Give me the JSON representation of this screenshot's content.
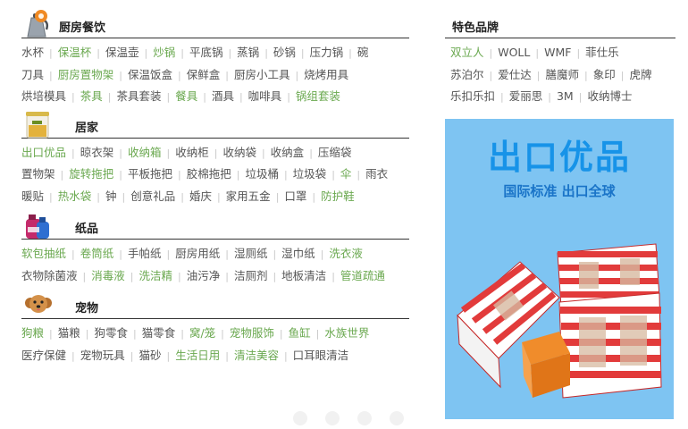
{
  "sections": [
    {
      "title": "厨房餐饮",
      "icon": "kettle-icon",
      "rows": [
        [
          {
            "t": "水杯",
            "hl": false
          },
          {
            "t": "保温杯",
            "hl": true
          },
          {
            "t": "保温壶",
            "hl": false
          },
          {
            "t": "炒锅",
            "hl": true
          },
          {
            "t": "平底锅",
            "hl": false
          },
          {
            "t": "蒸锅",
            "hl": false
          },
          {
            "t": "砂锅",
            "hl": false
          },
          {
            "t": "压力锅",
            "hl": false
          },
          {
            "t": "碗",
            "hl": false
          }
        ],
        [
          {
            "t": "刀具",
            "hl": false
          },
          {
            "t": "厨房置物架",
            "hl": true
          },
          {
            "t": "保温饭盒",
            "hl": false
          },
          {
            "t": "保鲜盒",
            "hl": false
          },
          {
            "t": "厨房小工具",
            "hl": false
          },
          {
            "t": "烧烤用具",
            "hl": false
          }
        ],
        [
          {
            "t": "烘培模具",
            "hl": false
          },
          {
            "t": "茶具",
            "hl": true
          },
          {
            "t": "茶具套装",
            "hl": false
          },
          {
            "t": "餐具",
            "hl": true
          },
          {
            "t": "酒具",
            "hl": false
          },
          {
            "t": "咖啡具",
            "hl": false
          },
          {
            "t": "锅组套装",
            "hl": true
          }
        ]
      ]
    },
    {
      "title": "居家",
      "icon": "storage-jar-icon",
      "rows": [
        [
          {
            "t": "出口优品",
            "hl": true
          },
          {
            "t": "晾衣架",
            "hl": false
          },
          {
            "t": "收纳箱",
            "hl": true
          },
          {
            "t": "收纳柜",
            "hl": false
          },
          {
            "t": "收纳袋",
            "hl": false
          },
          {
            "t": "收纳盒",
            "hl": false
          },
          {
            "t": "压缩袋",
            "hl": false
          }
        ],
        [
          {
            "t": "置物架",
            "hl": false
          },
          {
            "t": "旋转拖把",
            "hl": true
          },
          {
            "t": "平板拖把",
            "hl": false
          },
          {
            "t": "胶棉拖把",
            "hl": false
          },
          {
            "t": "垃圾桶",
            "hl": false
          },
          {
            "t": "垃圾袋",
            "hl": false
          },
          {
            "t": "伞",
            "hl": true
          },
          {
            "t": "雨衣",
            "hl": false
          }
        ],
        [
          {
            "t": "暖贴",
            "hl": false
          },
          {
            "t": "热水袋",
            "hl": true
          },
          {
            "t": "钟",
            "hl": false
          },
          {
            "t": "创意礼品",
            "hl": false
          },
          {
            "t": "婚庆",
            "hl": false
          },
          {
            "t": "家用五金",
            "hl": false
          },
          {
            "t": "口罩",
            "hl": false
          },
          {
            "t": "防护鞋",
            "hl": true
          }
        ]
      ]
    },
    {
      "title": "纸品",
      "icon": "detergent-bottle-icon",
      "rows": [
        [
          {
            "t": "软包抽纸",
            "hl": true
          },
          {
            "t": "卷筒纸",
            "hl": true
          },
          {
            "t": "手帕纸",
            "hl": false
          },
          {
            "t": "厨房用纸",
            "hl": false
          },
          {
            "t": "湿厕纸",
            "hl": false
          },
          {
            "t": "湿巾纸",
            "hl": false
          },
          {
            "t": "洗衣液",
            "hl": true
          }
        ],
        [
          {
            "t": "衣物除菌液",
            "hl": false
          },
          {
            "t": "消毒液",
            "hl": true
          },
          {
            "t": "洗洁精",
            "hl": true
          },
          {
            "t": "油污净",
            "hl": false
          },
          {
            "t": "洁厕剂",
            "hl": false
          },
          {
            "t": "地板清洁",
            "hl": false
          },
          {
            "t": "管道疏通",
            "hl": true
          }
        ]
      ]
    },
    {
      "title": "宠物",
      "icon": "dog-icon",
      "rows": [
        [
          {
            "t": "狗粮",
            "hl": true
          },
          {
            "t": "猫粮",
            "hl": false
          },
          {
            "t": "狗零食",
            "hl": false
          },
          {
            "t": "猫零食",
            "hl": false
          },
          {
            "t": "窝/笼",
            "hl": true
          },
          {
            "t": "宠物服饰",
            "hl": true
          },
          {
            "t": "鱼缸",
            "hl": true
          },
          {
            "t": "水族世界",
            "hl": true
          }
        ],
        [
          {
            "t": "医疗保健",
            "hl": false
          },
          {
            "t": "宠物玩具",
            "hl": false
          },
          {
            "t": "猫砂",
            "hl": false
          },
          {
            "t": "生活日用",
            "hl": true
          },
          {
            "t": "清洁美容",
            "hl": true
          },
          {
            "t": "口耳眼清洁",
            "hl": false
          }
        ]
      ]
    }
  ],
  "brands": {
    "title": "特色品牌",
    "rows": [
      [
        {
          "t": "双立人",
          "hl": true
        },
        {
          "t": "WOLL",
          "hl": false
        },
        {
          "t": "WMF",
          "hl": false
        },
        {
          "t": "菲仕乐",
          "hl": false
        }
      ],
      [
        {
          "t": "苏泊尔",
          "hl": false
        },
        {
          "t": "爱仕达",
          "hl": false
        },
        {
          "t": "膳魔师",
          "hl": false
        },
        {
          "t": "象印",
          "hl": false
        },
        {
          "t": "虎牌",
          "hl": false
        }
      ],
      [
        {
          "t": "乐扣乐扣",
          "hl": false
        },
        {
          "t": "爱丽思",
          "hl": false
        },
        {
          "t": "3M",
          "hl": false
        },
        {
          "t": "收纳博士",
          "hl": false
        }
      ]
    ]
  },
  "banner": {
    "title": "出口优品",
    "subtitle": "国际标准 出口全球",
    "bg_color": "#7ec4f2",
    "title_color": "#1793e8"
  },
  "colors": {
    "highlight": "#6aa84f",
    "normal": "#555555",
    "separator": "#c8c8c8"
  },
  "carousel_dots": 4
}
